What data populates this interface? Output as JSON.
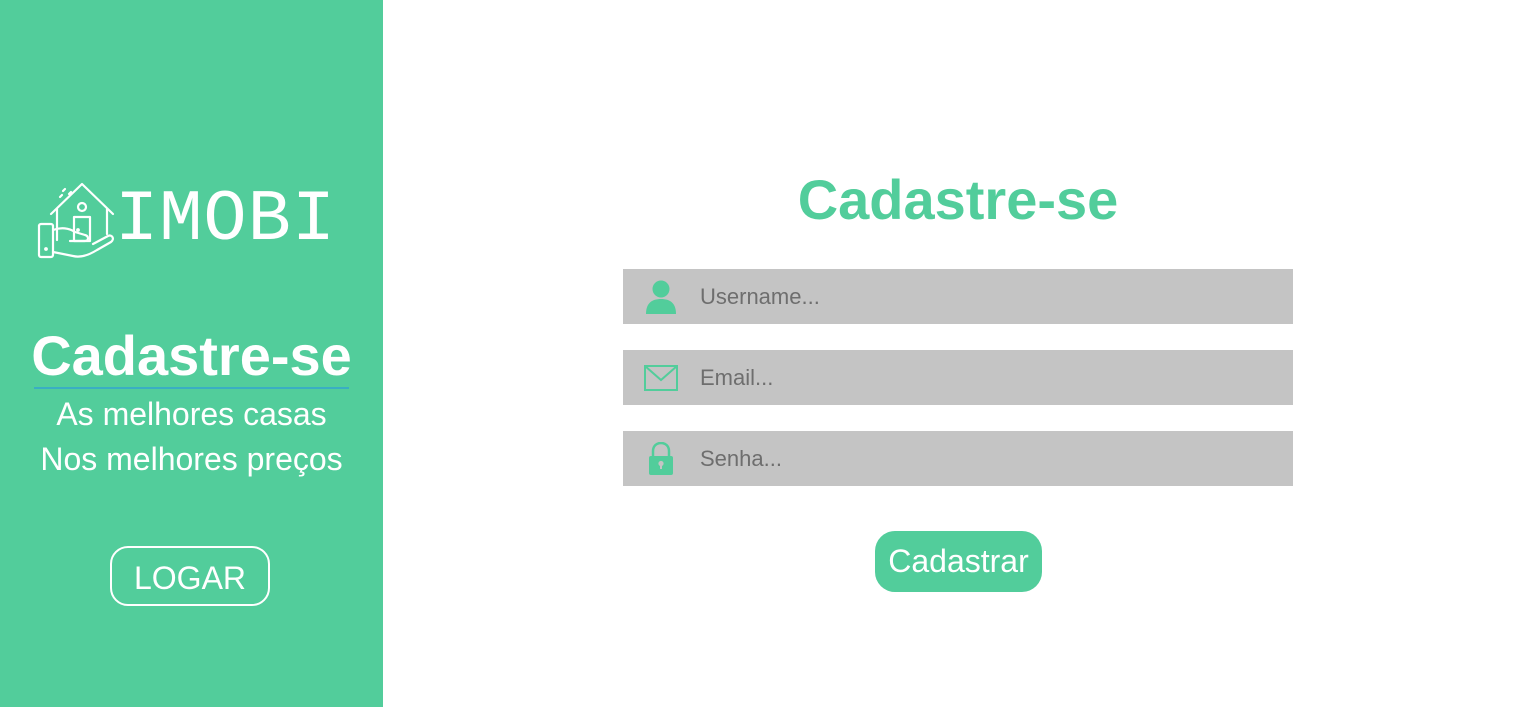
{
  "colors": {
    "accent": "#52cd9b",
    "field_background": "#c4c4c4",
    "underline": "#3aaec3",
    "text_on_accent": "#ffffff"
  },
  "sidebar": {
    "logo_icon": "house-in-hand-icon",
    "logo_text": "IMOBI",
    "title": "Cadastre-se",
    "subtitle_line1": "As melhores casas",
    "subtitle_line2": "Nos melhores preços",
    "login_button_label": "LOGAR"
  },
  "form": {
    "title": "Cadastre-se",
    "fields": [
      {
        "icon": "user-icon",
        "placeholder": "Username...",
        "value": ""
      },
      {
        "icon": "envelope-icon",
        "placeholder": "Email...",
        "value": ""
      },
      {
        "icon": "lock-icon",
        "placeholder": "Senha...",
        "value": ""
      }
    ],
    "submit_label": "Cadastrar"
  }
}
